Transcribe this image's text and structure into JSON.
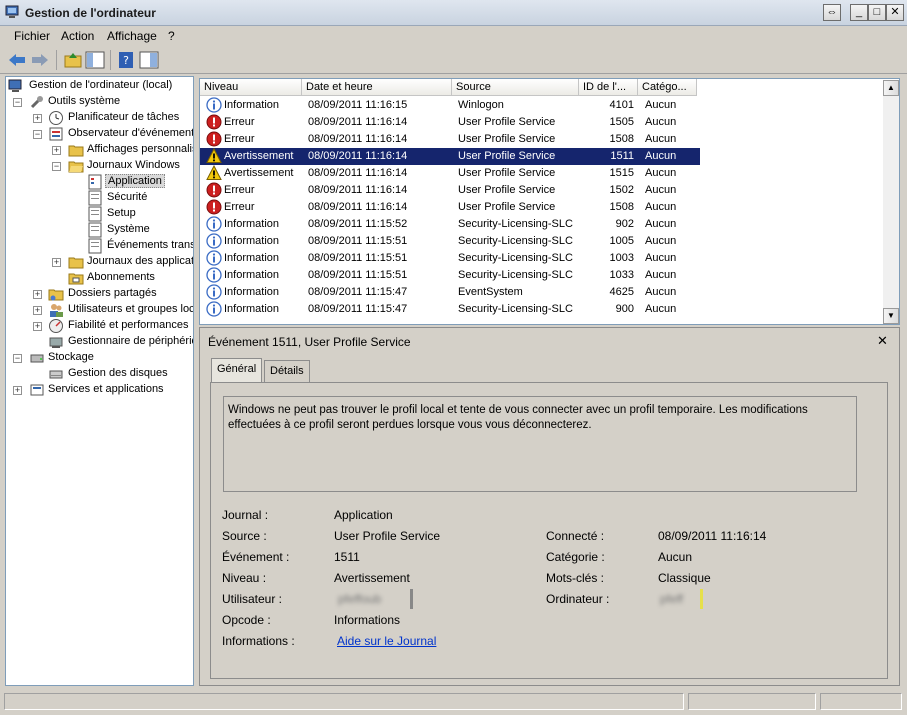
{
  "window": {
    "title": "Gestion de l'ordinateur"
  },
  "menu": {
    "file": "Fichier",
    "action": "Action",
    "view": "Affichage",
    "help": "?"
  },
  "tree": {
    "root": "Gestion de l'ordinateur (local)",
    "system_tools": "Outils système",
    "task_scheduler": "Planificateur de tâches",
    "event_viewer": "Observateur d'événements",
    "custom_views": "Affichages personnalisés",
    "windows_logs": "Journaux Windows",
    "application": "Application",
    "security": "Sécurité",
    "setup": "Setup",
    "system": "Système",
    "forwarded": "Événements transférés",
    "app_service_logs": "Journaux des applications et des services",
    "subscriptions": "Abonnements",
    "shared_folders": "Dossiers partagés",
    "local_users": "Utilisateurs et groupes locaux",
    "reliability": "Fiabilité et performances",
    "device_manager": "Gestionnaire de périphériques",
    "storage": "Stockage",
    "disk_mgmt": "Gestion des disques",
    "services_apps": "Services et applications"
  },
  "grid": {
    "columns": {
      "level": "Niveau",
      "datetime": "Date et heure",
      "source": "Source",
      "eventid": "ID de l'...",
      "category": "Catégo..."
    },
    "rows": [
      {
        "level": "Information",
        "icon": "info-icon",
        "datetime": "08/09/2011 11:16:15",
        "source": "Winlogon",
        "id": "4101",
        "category": "Aucun"
      },
      {
        "level": "Erreur",
        "icon": "error-icon",
        "datetime": "08/09/2011 11:16:14",
        "source": "User Profile Service",
        "id": "1505",
        "category": "Aucun"
      },
      {
        "level": "Erreur",
        "icon": "error-icon",
        "datetime": "08/09/2011 11:16:14",
        "source": "User Profile Service",
        "id": "1508",
        "category": "Aucun"
      },
      {
        "level": "Avertissement",
        "icon": "warning-icon",
        "datetime": "08/09/2011 11:16:14",
        "source": "User Profile Service",
        "id": "1511",
        "category": "Aucun",
        "selected": true
      },
      {
        "level": "Avertissement",
        "icon": "warning-icon",
        "datetime": "08/09/2011 11:16:14",
        "source": "User Profile Service",
        "id": "1515",
        "category": "Aucun"
      },
      {
        "level": "Erreur",
        "icon": "error-icon",
        "datetime": "08/09/2011 11:16:14",
        "source": "User Profile Service",
        "id": "1502",
        "category": "Aucun"
      },
      {
        "level": "Erreur",
        "icon": "error-icon",
        "datetime": "08/09/2011 11:16:14",
        "source": "User Profile Service",
        "id": "1508",
        "category": "Aucun"
      },
      {
        "level": "Information",
        "icon": "info-icon",
        "datetime": "08/09/2011 11:15:52",
        "source": "Security-Licensing-SLC",
        "id": "902",
        "category": "Aucun"
      },
      {
        "level": "Information",
        "icon": "info-icon",
        "datetime": "08/09/2011 11:15:51",
        "source": "Security-Licensing-SLC",
        "id": "1005",
        "category": "Aucun"
      },
      {
        "level": "Information",
        "icon": "info-icon",
        "datetime": "08/09/2011 11:15:51",
        "source": "Security-Licensing-SLC",
        "id": "1003",
        "category": "Aucun"
      },
      {
        "level": "Information",
        "icon": "info-icon",
        "datetime": "08/09/2011 11:15:51",
        "source": "Security-Licensing-SLC",
        "id": "1033",
        "category": "Aucun"
      },
      {
        "level": "Information",
        "icon": "info-icon",
        "datetime": "08/09/2011 11:15:47",
        "source": "EventSystem",
        "id": "4625",
        "category": "Aucun"
      },
      {
        "level": "Information",
        "icon": "info-icon",
        "datetime": "08/09/2011 11:15:47",
        "source": "Security-Licensing-SLC",
        "id": "900",
        "category": "Aucun"
      }
    ]
  },
  "detail": {
    "title": "Événement 1511, User Profile Service",
    "tab_general": "Général",
    "tab_details": "Détails",
    "message": "Windows ne peut pas trouver le profil local et tente de vous connecter avec un profil temporaire. Les modifications effectuées à ce profil seront perdues lorsque vous vous déconnecterez.",
    "labels": {
      "log": "Journal :",
      "source": "Source :",
      "event": "Événement :",
      "level": "Niveau :",
      "user": "Utilisateur :",
      "opcode": "Opcode :",
      "info": "Informations :",
      "logged": "Connecté :",
      "category": "Catégorie :",
      "keywords": "Mots-clés :",
      "computer": "Ordinateur :"
    },
    "values": {
      "log": "Application",
      "source": "User Profile Service",
      "event": "1511",
      "level": "Avertissement",
      "user": "pfeffoub",
      "opcode": "Informations",
      "info_link": "Aide sur le Journal",
      "logged": "08/09/2011 11:16:14",
      "category": "Aucun",
      "keywords": "Classique",
      "computer": "pfeff"
    }
  },
  "colors": {
    "selection": "#15256d",
    "link": "#0033cc",
    "error": "#cc1f1f",
    "warning": "#f2c80c",
    "info": "#3a6bc4"
  }
}
